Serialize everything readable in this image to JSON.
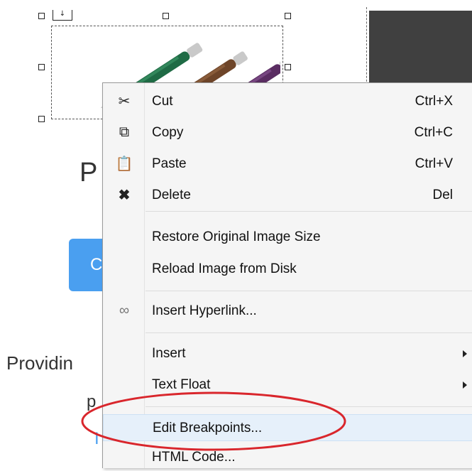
{
  "editor": {
    "anchor_glyph": "↓",
    "heading_fragment": "P",
    "button_fragment": "C",
    "text_fragment": "Providin",
    "text_fragment_2": "p",
    "link_fragment": "I"
  },
  "context_menu": {
    "items": [
      {
        "label": "Cut",
        "shortcut": "Ctrl+X",
        "icon": "scissors-icon"
      },
      {
        "label": "Copy",
        "shortcut": "Ctrl+C",
        "icon": "copy-icon"
      },
      {
        "label": "Paste",
        "shortcut": "Ctrl+V",
        "icon": "paste-icon"
      },
      {
        "label": "Delete",
        "shortcut": "Del",
        "icon": "delete-x-icon"
      },
      {
        "label": "Restore Original Image Size",
        "shortcut": ""
      },
      {
        "label": "Reload Image from Disk",
        "shortcut": ""
      },
      {
        "label": "Insert Hyperlink...",
        "shortcut": "",
        "icon": "link-icon"
      },
      {
        "label": "Insert",
        "shortcut": "",
        "submenu": true
      },
      {
        "label": "Text Float",
        "shortcut": "",
        "submenu": true
      },
      {
        "label": "Edit Breakpoints...",
        "shortcut": "",
        "highlighted": true
      },
      {
        "label": "HTML Code...",
        "shortcut": ""
      }
    ]
  },
  "colors": {
    "accent_blue": "#4a9ff0",
    "annotation_red": "#d9262c",
    "menu_bg": "#f5f5f5",
    "dark_block": "#404040"
  }
}
